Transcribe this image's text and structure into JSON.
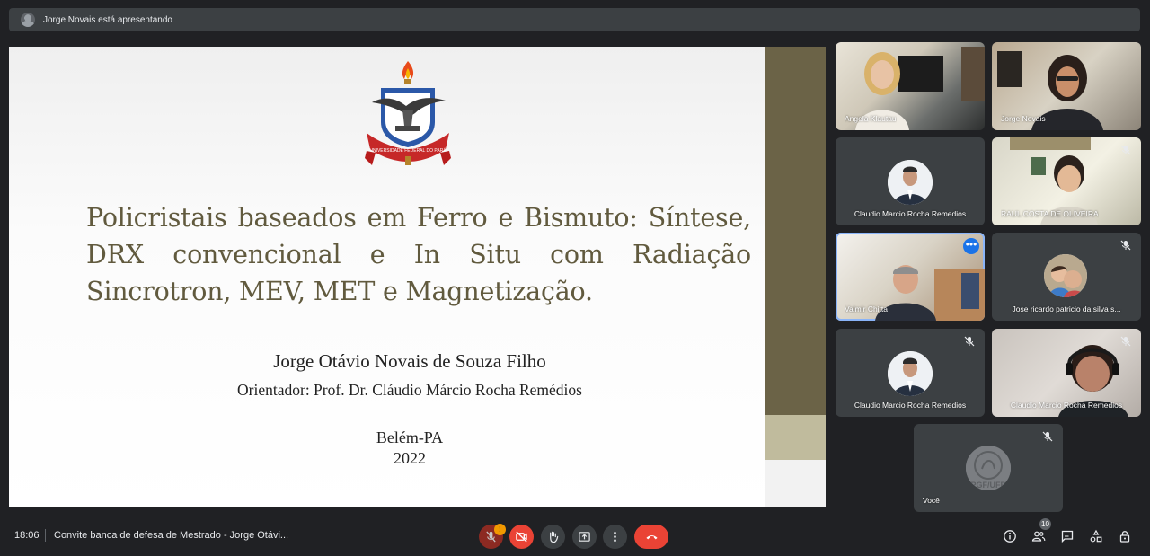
{
  "banner": {
    "text": "Jorge Novais está apresentando"
  },
  "slide": {
    "crest_text": "UNIVERSIDADE FEDERAL DO PARÁ",
    "title": "Policristais baseados em Ferro e Bismuto: Síntese, DRX convencional e In Situ com Radiação Sincrotron, MEV, MET e Magnetização.",
    "author": "Jorge Otávio Novais de Souza Filho",
    "advisor": "Orientador: Prof. Dr. Cláudio Márcio Rocha Remédios",
    "city": "Belém-PA",
    "year": "2022"
  },
  "participants": [
    {
      "name": "Angela Klautau"
    },
    {
      "name": "Jorge Novais"
    },
    {
      "name": "Claudio Marcio Rocha Remedios"
    },
    {
      "name": "RAUL COSTA DE OLIVEIRA"
    },
    {
      "name": "Valmir Chitta"
    },
    {
      "name": "Jose ricardo patricio da silva s..."
    },
    {
      "name": "Claudio Marcio Rocha Remedios"
    },
    {
      "name": "Claudio Marcio Rocha Remedios"
    },
    {
      "name": "Você"
    }
  ],
  "self_avatar_text": "PGF/UFP",
  "bottom": {
    "time": "18:06",
    "meeting_title": "Convite banca de defesa de Mestrado - Jorge Otávi...",
    "mic_badge": "!",
    "people_count": "10"
  },
  "colors": {
    "accent": "#8ab4f8",
    "hangup": "#ea4335",
    "warning": "#f29900"
  },
  "icons": [
    "mic-off-icon",
    "camera-off-icon",
    "raise-hand-icon",
    "present-icon",
    "more-options-icon",
    "hang-up-icon",
    "info-icon",
    "people-icon",
    "chat-icon",
    "activities-icon",
    "host-controls-icon"
  ]
}
